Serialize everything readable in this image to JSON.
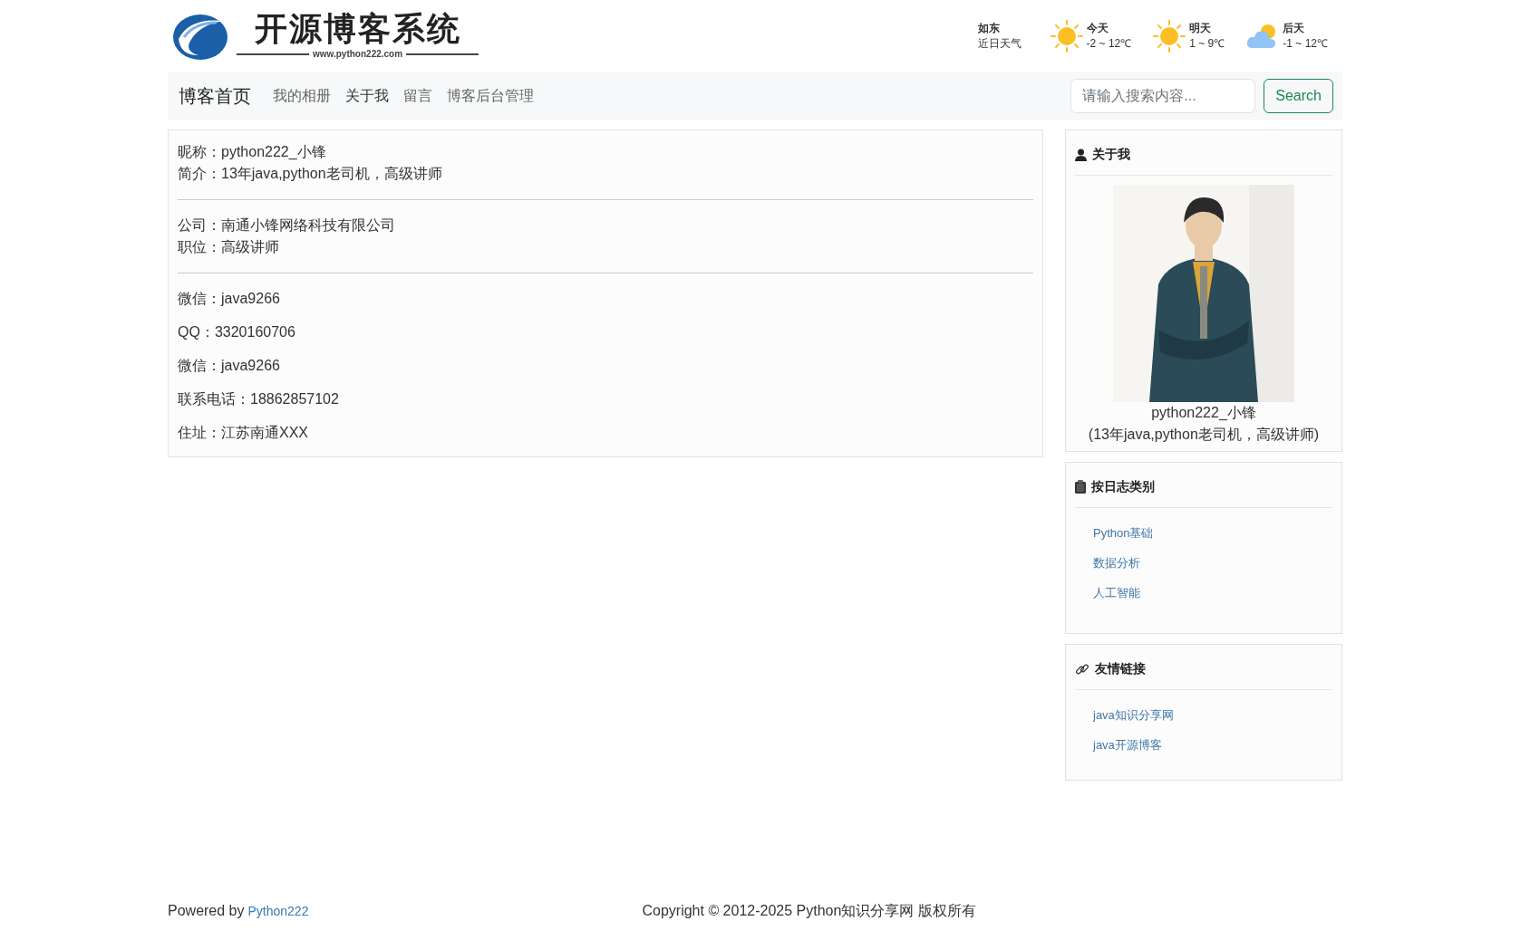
{
  "logo": {
    "title": "开源博客系统",
    "url": "www.python222.com"
  },
  "weather": {
    "city": "如东",
    "caption": "近日天气",
    "days": [
      {
        "kind": "sun",
        "label": "今天",
        "range": "-2 ~ 12℃"
      },
      {
        "kind": "sun",
        "label": "明天",
        "range": "1 ~ 9℃"
      },
      {
        "kind": "cloud",
        "label": "后天",
        "range": "-1 ~ 12℃"
      }
    ]
  },
  "navbar": {
    "brand": "博客首页",
    "links": [
      "我的相册",
      "关于我",
      "留言",
      "博客后台管理"
    ],
    "search": {
      "placeholder": "请输入搜索内容..."
    },
    "search_button": "Search"
  },
  "profile": {
    "groups": [
      {
        "kind": "info",
        "lines": [
          "昵称：python222_小锋",
          "简介：13年java,python老司机，高级讲师"
        ]
      },
      {
        "kind": "info",
        "lines": [
          "公司：南通小锋网络科技有限公司",
          "职位：高级讲师"
        ]
      },
      {
        "kind": "contact",
        "lines": [
          "微信：java9266",
          "QQ：3320160706",
          "微信：java9266",
          "联系电话：18862857102",
          "住址：江苏南通XXX"
        ]
      }
    ]
  },
  "sidebar": [
    {
      "kind": "about",
      "title": "关于我",
      "name": "python222_小锋",
      "bio": "(13年java,python老司机，高级讲师)"
    },
    {
      "kind": "categories",
      "title": "按日志类别",
      "links": [
        "Python基础",
        "数据分析",
        "人工智能"
      ]
    },
    {
      "kind": "friends",
      "title": "友情链接",
      "links": [
        "java知识分享网",
        "java开源博客"
      ]
    }
  ],
  "footer": {
    "powered_by": "Powered by",
    "powered_link": "Python222",
    "copyright": "Copyright © 2012-2025 Python知识分享网 版权所有"
  }
}
